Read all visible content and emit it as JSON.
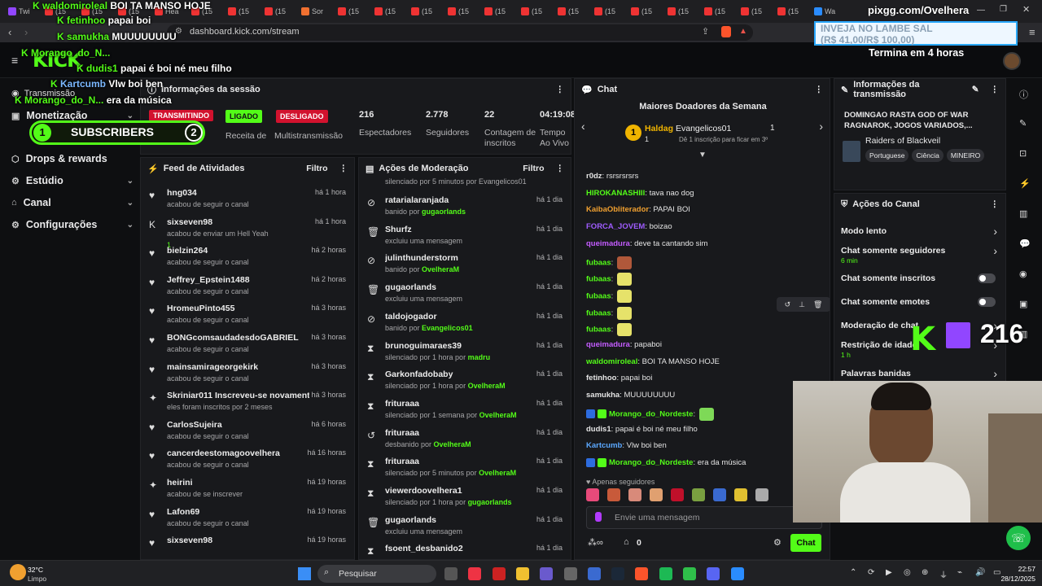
{
  "browser": {
    "tabs": [
      "Twi",
      "(15",
      "(15",
      "(15",
      "Hea",
      "(15",
      "(15",
      "(15",
      "Sor",
      "(15",
      "(15",
      "(15",
      "(15",
      "(15",
      "(15",
      "(15",
      "(15",
      "(15",
      "(15",
      "(15",
      "(15",
      "(15",
      "Wa"
    ],
    "url": "dashboard.kick.com/stream",
    "window_overlay": "pixgg.com/Ovelhera"
  },
  "overlay": {
    "chat": [
      {
        "user": "waldomiroleal",
        "msg": "BOI TA MANSO HOJE"
      },
      {
        "user": "fetinhoo",
        "msg": "papai boi"
      },
      {
        "user": "samukha",
        "msg": "MUUUUUUUU"
      },
      {
        "user": "Morango_do_N...",
        "msg": ""
      },
      {
        "user": "dudis1",
        "msg": "papai é boi né meu filho"
      },
      {
        "user": "Kartcumb",
        "msg": "Vlw boi ben"
      },
      {
        "user": "Morango_do_N...",
        "msg": "era da música"
      }
    ],
    "subs_label": "SUBSCRIBERS",
    "subs_left": "1",
    "subs_right": "2",
    "donation_title": "INVEJA NO LAMBE SAL",
    "donation_value": "(R$ 41,00/R$ 100,00)",
    "ends_in": "Termina em 4 horas",
    "follower_count": "216"
  },
  "sidebar": {
    "transmission": "Transmissão",
    "items": [
      {
        "label": "Monetização",
        "icon": "wallet-icon"
      },
      {
        "label": "Drops & rewards",
        "icon": "drops-icon"
      },
      {
        "label": "Estúdio",
        "icon": "studio-icon"
      },
      {
        "label": "Canal",
        "icon": "channel-icon"
      },
      {
        "label": "Configurações",
        "icon": "gear-icon"
      }
    ]
  },
  "session": {
    "title": "Informações da sessão",
    "status_live": "TRANSMITINDO",
    "status_on": "LIGADO",
    "status_off": "DESLIGADO",
    "labels": [
      "Receita de",
      "Multistransmissão"
    ],
    "stats": [
      {
        "value": "216",
        "label": "Espectadores"
      },
      {
        "value": "2.778",
        "label": "Seguidores"
      },
      {
        "value": "22",
        "label": "Contagem de inscritos"
      },
      {
        "value": "04:19:08",
        "label": "Tempo Ao Vivo"
      }
    ]
  },
  "activity_feed": {
    "title": "Feed de Atividades",
    "filter": "Filtro",
    "items": [
      {
        "name": "hng034",
        "sub": "acabou de seguir o canal",
        "time": "há 1 hora",
        "icon": "heart-icon"
      },
      {
        "name": "sixseven98",
        "sub": "acabou de enviar um Hell Yeah",
        "time": "há 1 hora",
        "icon": "kick-icon",
        "extra": "1"
      },
      {
        "name": "bielzin264",
        "sub": "acabou de seguir o canal",
        "time": "há 2 horas",
        "icon": "heart-icon"
      },
      {
        "name": "Jeffrey_Epstein1488",
        "sub": "acabou de seguir o canal",
        "time": "há 2 horas",
        "icon": "heart-icon"
      },
      {
        "name": "HromeuPinto455",
        "sub": "acabou de seguir o canal",
        "time": "há 3 horas",
        "icon": "heart-icon"
      },
      {
        "name": "BONGcomsaudadesdoGABRIEL",
        "sub": "acabou de seguir o canal",
        "time": "há 3 horas",
        "icon": "heart-icon"
      },
      {
        "name": "mainsamirageorgekirk",
        "sub": "acabou de seguir o canal",
        "time": "há 3 horas",
        "icon": "heart-icon"
      },
      {
        "name": "Skriniar011 Inscreveu-se novamente!",
        "sub": "eles foram inscritos por 2 meses",
        "time": "há 3 horas",
        "icon": "star-icon"
      },
      {
        "name": "CarlosSujeira",
        "sub": "acabou de seguir o canal",
        "time": "há 6 horas",
        "icon": "heart-icon"
      },
      {
        "name": "cancerdeestomagoovelhera",
        "sub": "acabou de seguir o canal",
        "time": "há 16 horas",
        "icon": "heart-icon"
      },
      {
        "name": "heirini",
        "sub": "acabou de se inscrever",
        "time": "há 19 horas",
        "icon": "star-icon"
      },
      {
        "name": "Lafon69",
        "sub": "acabou de seguir o canal",
        "time": "há 19 horas",
        "icon": "heart-icon"
      },
      {
        "name": "sixseven98",
        "sub": "",
        "time": "há 19 horas",
        "icon": "heart-icon"
      }
    ]
  },
  "mod_actions": {
    "title": "Ações de Moderação",
    "filter": "Filtro",
    "top_partial": "silenciado por 5 minutos por Evangelicos01",
    "items": [
      {
        "name": "ratarialaranjada",
        "pre": "banido por ",
        "by": "gugaorlands",
        "time": "há 1 dia",
        "icon": "ban-icon"
      },
      {
        "name": "Shurfz",
        "pre": "excluiu uma mensagem",
        "by": "",
        "time": "há 1 dia",
        "icon": "trash-icon"
      },
      {
        "name": "julinthunderstorm",
        "pre": "banido por ",
        "by": "OvelheraM",
        "time": "há 1 dia",
        "icon": "ban-icon"
      },
      {
        "name": "gugaorlands",
        "pre": "excluiu uma mensagem",
        "by": "",
        "time": "há 1 dia",
        "icon": "trash-icon"
      },
      {
        "name": "taldojogador",
        "pre": "banido por ",
        "by": "Evangelicos01",
        "time": "há 1 dia",
        "icon": "ban-icon"
      },
      {
        "name": "brunoguimaraes39",
        "pre": "silenciado por 1 hora por ",
        "by": "madru",
        "time": "há 1 dia",
        "icon": "hourglass-icon"
      },
      {
        "name": "Garkonfadobaby",
        "pre": "silenciado por 1 hora por ",
        "by": "OvelheraM",
        "time": "há 1 dia",
        "icon": "hourglass-icon"
      },
      {
        "name": "frituraaa",
        "pre": "silenciado por 1 semana por ",
        "by": "OvelheraM",
        "time": "há 1 dia",
        "icon": "hourglass-icon"
      },
      {
        "name": "frituraaa",
        "pre": "desbanido por ",
        "by": "OvelheraM",
        "time": "há 1 dia",
        "icon": "undo-icon"
      },
      {
        "name": "frituraaa",
        "pre": "silenciado por 5 minutos por ",
        "by": "OvelheraM",
        "time": "há 1 dia",
        "icon": "hourglass-icon"
      },
      {
        "name": "viewerdoovelhera1",
        "pre": "silenciado por 1 hora por ",
        "by": "gugaorlands",
        "time": "há 1 dia",
        "icon": "hourglass-icon"
      },
      {
        "name": "gugaorlands",
        "pre": "excluiu uma mensagem",
        "by": "",
        "time": "há 1 dia",
        "icon": "trash-icon"
      },
      {
        "name": "fsoent_desbanido2",
        "pre": "",
        "by": "",
        "time": "há 1 dia",
        "icon": "hourglass-icon"
      }
    ]
  },
  "chat": {
    "title": "Chat",
    "top_donors_title": "Maiores Doadores da Semana",
    "donor1": "Haldag",
    "donor1_sub": "1",
    "donor2": "Evangelicos01",
    "donor2_count": "1",
    "donor2_sub": "Dê 1 inscrição para ficar em 3º",
    "messages": [
      {
        "user": "r0dz",
        "color": "#e4e4e4",
        "text": "rsrsrsrsrs"
      },
      {
        "user": "HIROKANASHIII",
        "color": "#53fc18",
        "text": "tava nao dog"
      },
      {
        "user": "KaibaObliterador",
        "color": "#f0a030",
        "text": "PAPAI BOI"
      },
      {
        "user": "FORCA_JOVEM",
        "color": "#9f5cff",
        "text": "boizao"
      },
      {
        "user": "queimadura",
        "color": "#c45cff",
        "text": "deve ta cantando sim"
      },
      {
        "user": "fubaas",
        "color": "#53fc18",
        "text": ""
      },
      {
        "user": "fubaas",
        "color": "#53fc18",
        "text": ""
      },
      {
        "user": "fubaas",
        "color": "#53fc18",
        "text": ""
      },
      {
        "user": "fubaas",
        "color": "#53fc18",
        "text": ""
      },
      {
        "user": "fubaas",
        "color": "#53fc18",
        "text": ""
      },
      {
        "user": "queimadura",
        "color": "#c45cff",
        "text": "papaboi"
      },
      {
        "user": "waldomiroleal",
        "color": "#53fc18",
        "text": "BOI TA MANSO HOJE"
      },
      {
        "user": "fetinhoo",
        "color": "#e4e4e4",
        "text": "papai boi"
      },
      {
        "user": "samukha",
        "color": "#e4e4e4",
        "text": "MUUUUUUUU"
      },
      {
        "user": "Morango_do_Nordeste",
        "color": "#53fc18",
        "text": ""
      },
      {
        "user": "dudis1",
        "color": "#e4e4e4",
        "text": "papai é boi né meu filho"
      },
      {
        "user": "Kartcumb",
        "color": "#5ba8ff",
        "text": "Vlw boi ben"
      },
      {
        "user": "Morango_do_Nordeste",
        "color": "#53fc18",
        "text": "era da música"
      }
    ],
    "followers_only": "Apenas seguidores",
    "input_placeholder": "Envie uma mensagem",
    "count": "0",
    "send_label": "Chat"
  },
  "transmission_info": {
    "title": "Informações da transmissão",
    "stream_title": "DOMINGAO RASTA GOD OF WAR RAGNAROK, JOGOS VARIADOS,...",
    "game": "Raiders of Blackveil",
    "tags": [
      "Portuguese",
      "Ciência",
      "MINEIRO"
    ]
  },
  "channel_actions": {
    "title": "Ações do Canal",
    "rows": [
      {
        "label": "Modo lento",
        "sub": "",
        "control": "chevron"
      },
      {
        "label": "Chat somente seguidores",
        "sub": "6 min",
        "control": "chevron"
      },
      {
        "label": "Chat somente inscritos",
        "sub": "",
        "control": "toggle"
      },
      {
        "label": "Chat somente emotes",
        "sub": "",
        "control": "toggle"
      },
      {
        "label": "Moderação de chat",
        "sub": "",
        "control": "chevron"
      },
      {
        "label": "Restrição de idade",
        "sub": "1 h",
        "control": "chevron"
      },
      {
        "label": "Palavras banidas",
        "sub": "",
        "control": "chevron"
      }
    ]
  },
  "taskbar": {
    "weather_temp": "32°C",
    "weather_desc": "Limpo",
    "search_placeholder": "Pesquisar",
    "time": "22:57",
    "date": "28/12/2025"
  }
}
